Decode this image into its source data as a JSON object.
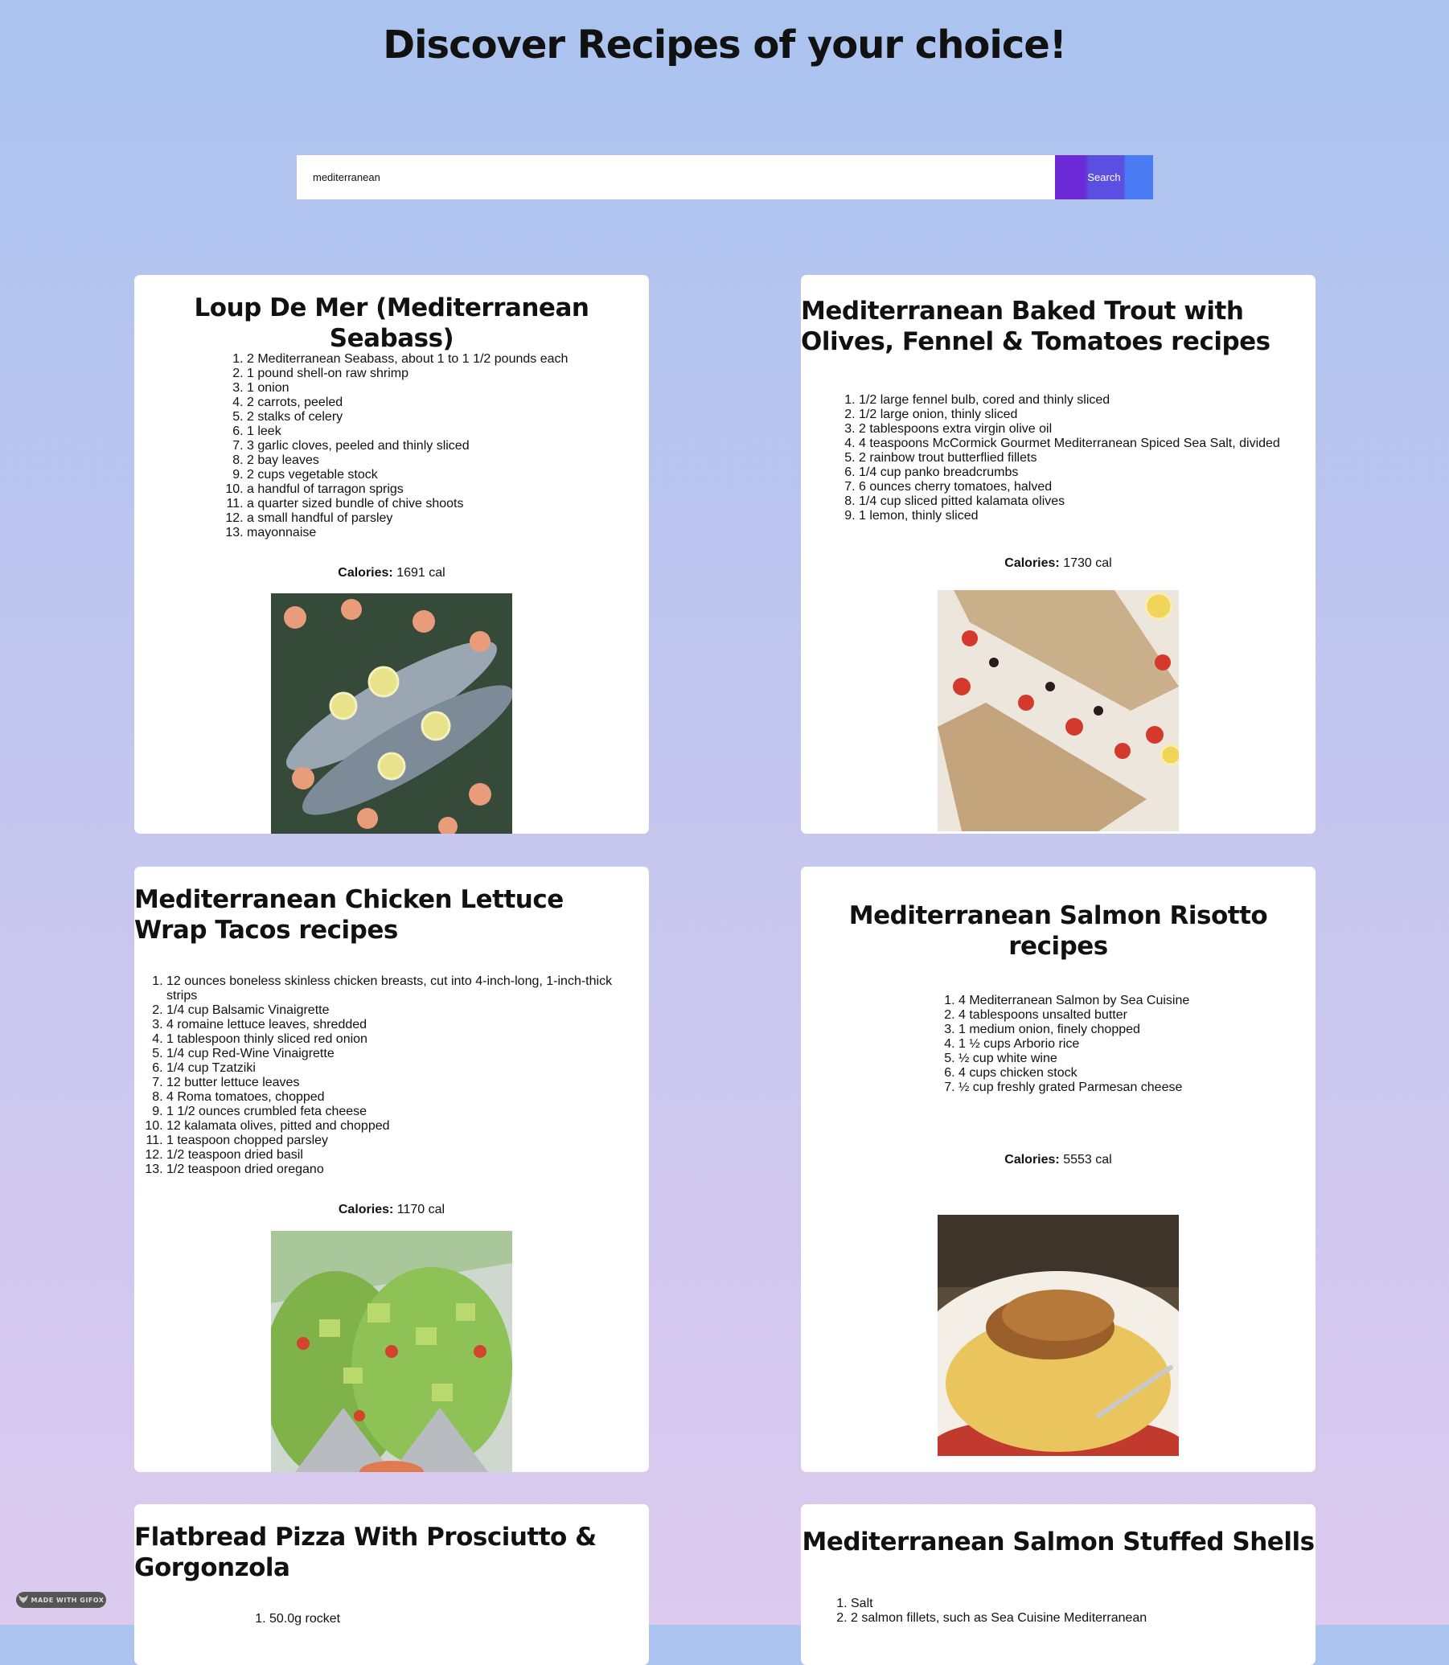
{
  "header": {
    "title": "Discover Recipes of your choice!"
  },
  "search": {
    "value": "mediterranean",
    "button_label": "Search"
  },
  "calories_label": "Calories:",
  "recipes": [
    {
      "title": "Loup De Mer (Mediterranean Seabass)",
      "ingredients": [
        "2 Mediterranean Seabass, about 1 to 1 1/2 pounds each",
        "1 pound shell-on raw shrimp",
        "1 onion",
        "2 carrots, peeled",
        "2 stalks of celery",
        "1 leek",
        "3 garlic cloves, peeled and thinly sliced",
        "2 bay leaves",
        "2 cups vegetable stock",
        "a handful of tarragon sprigs",
        "a quarter sized bundle of chive shoots",
        "a small handful of parsley",
        "mayonnaise"
      ],
      "calories": "1691 cal"
    },
    {
      "title": "Mediterranean Baked Trout with Olives, Fennel & Tomatoes recipes",
      "ingredients": [
        "1/2 large fennel bulb, cored and thinly sliced",
        "1/2 large onion, thinly sliced",
        "2 tablespoons extra virgin olive oil",
        "4 teaspoons McCormick Gourmet Mediterranean Spiced Sea Salt, divided",
        "2 rainbow trout butterflied fillets",
        "1/4 cup panko breadcrumbs",
        "6 ounces cherry tomatoes, halved",
        "1/4 cup sliced pitted kalamata olives",
        "1 lemon, thinly sliced"
      ],
      "calories": "1730 cal"
    },
    {
      "title": "Mediterranean Chicken Lettuce Wrap Tacos recipes",
      "ingredients": [
        "12 ounces boneless skinless chicken breasts, cut into 4-inch-long, 1-inch-thick strips",
        "1/4 cup Balsamic Vinaigrette",
        "4 romaine lettuce leaves, shredded",
        "1 tablespoon thinly sliced red onion",
        "1/4 cup Red-Wine Vinaigrette",
        "1/4 cup Tzatziki",
        "12 butter lettuce leaves",
        "4 Roma tomatoes, chopped",
        "1 1/2 ounces crumbled feta cheese",
        "12 kalamata olives, pitted and chopped",
        "1 teaspoon chopped parsley",
        "1/2 teaspoon dried basil",
        "1/2 teaspoon dried oregano"
      ],
      "calories": "1170 cal"
    },
    {
      "title": "Mediterranean Salmon Risotto recipes",
      "ingredients": [
        "4 Mediterranean Salmon by Sea Cuisine",
        "4 tablespoons unsalted butter",
        "1 medium onion, finely chopped",
        "1 ½ cups Arborio rice",
        "½ cup white wine",
        "4 cups chicken stock",
        "½ cup freshly grated Parmesan cheese"
      ],
      "calories": "5553 cal"
    },
    {
      "title": "Flatbread Pizza With Prosciutto & Gorgonzola",
      "ingredients": [
        "50.0g rocket"
      ]
    },
    {
      "title": "Mediterranean Salmon Stuffed Shells",
      "ingredients": [
        "Salt",
        "2 salmon fillets, such as Sea Cuisine Mediterranean"
      ]
    }
  ],
  "footer_badge": "MADE WITH GIFOX"
}
